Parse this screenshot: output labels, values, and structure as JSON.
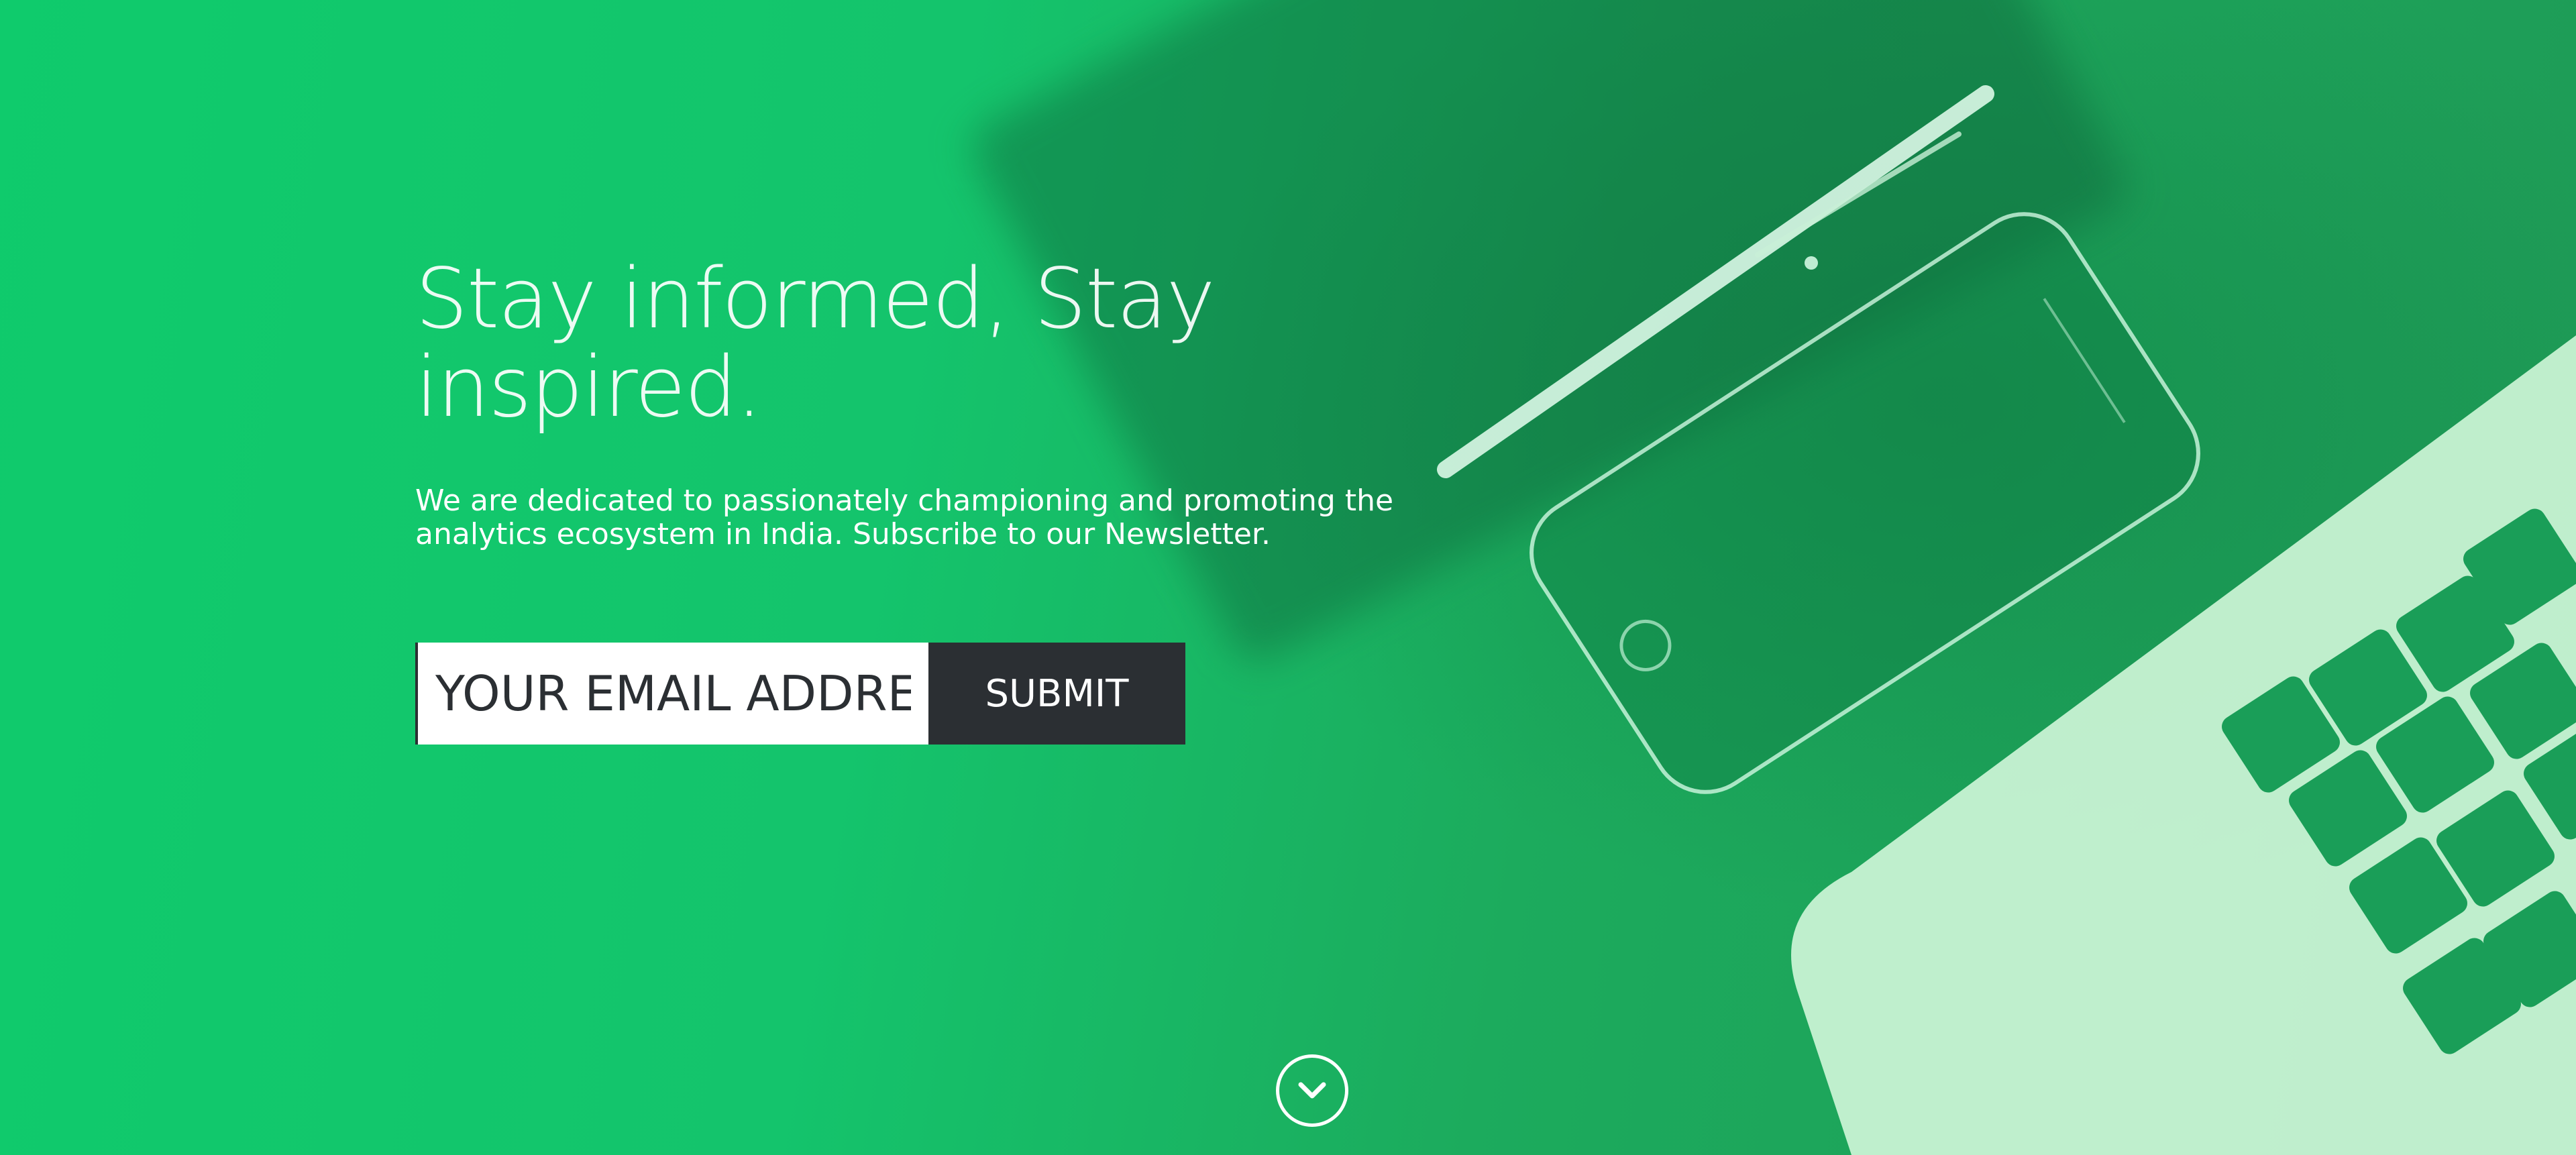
{
  "hero": {
    "headline": "Stay informed, Stay inspired.",
    "subtext": "We are dedicated to passionately championing and promoting the analytics ecosystem in India. Subscribe to our Newsletter."
  },
  "form": {
    "email_placeholder": "YOUR EMAIL ADDRESS",
    "submit_label": "SUBMIT"
  },
  "scroll_down": {
    "icon": "chevron-down-icon"
  },
  "colors": {
    "brand_green": "#12c96d",
    "button_dark": "#2b2f33",
    "text_light": "#ffffff"
  }
}
